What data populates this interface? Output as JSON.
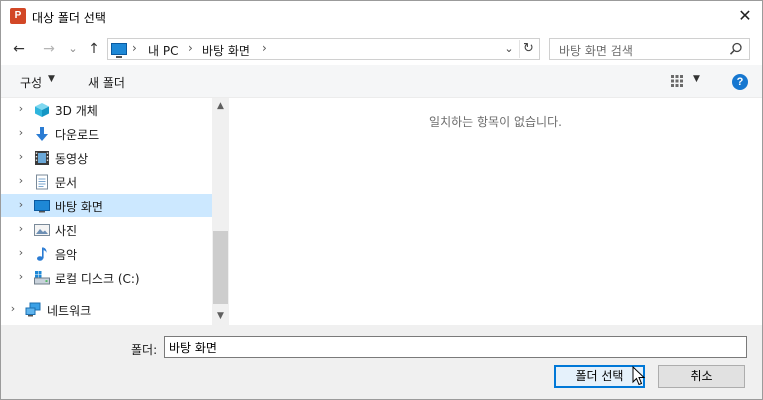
{
  "window": {
    "title": "대상 폴더 선택",
    "app_icon_letter": "P",
    "close_glyph": "✕"
  },
  "nav": {
    "back_glyph": "←",
    "forward_glyph": "→",
    "recent_glyph": "⌄",
    "up_glyph": "↑",
    "breadcrumb": [
      "내 PC",
      "바탕 화면"
    ],
    "crumb_sep": "›",
    "dropdown_glyph": "⌄",
    "refresh_glyph": "↻"
  },
  "search": {
    "placeholder": "바탕 화면 검색"
  },
  "toolbar": {
    "organize_label": "구성",
    "organize_caret": "▼",
    "new_folder_label": "새 폴더",
    "view_caret": "▼",
    "help_glyph": "?"
  },
  "tree": {
    "chevron": "›",
    "items": [
      {
        "label": "3D 개체",
        "icon": "3d-objects-icon"
      },
      {
        "label": "다운로드",
        "icon": "downloads-icon"
      },
      {
        "label": "동영상",
        "icon": "videos-icon"
      },
      {
        "label": "문서",
        "icon": "documents-icon"
      },
      {
        "label": "바탕 화면",
        "icon": "desktop-icon",
        "selected": true
      },
      {
        "label": "사진",
        "icon": "pictures-icon"
      },
      {
        "label": "음악",
        "icon": "music-icon"
      },
      {
        "label": "로컬 디스크 (C:)",
        "icon": "local-disk-icon"
      },
      {
        "label": "네트워크",
        "icon": "network-icon"
      }
    ],
    "scroll_up_glyph": "▲",
    "scroll_down_glyph": "▼"
  },
  "content": {
    "empty_message": "일치하는 항목이 없습니다."
  },
  "footer": {
    "folder_label": "폴더:",
    "folder_value": "바탕 화면",
    "select_button": "폴더 선택",
    "cancel_button": "취소"
  },
  "colors": {
    "accent": "#0078d7",
    "selected_bg": "#cce8ff",
    "app_icon": "#d24726",
    "help_icon": "#1677d0"
  }
}
